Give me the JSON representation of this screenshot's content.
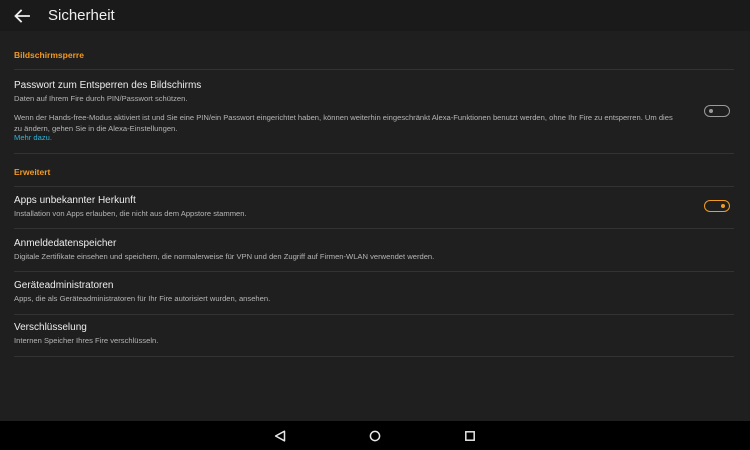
{
  "header": {
    "title": "Sicherheit",
    "back_icon": "arrow-left-icon"
  },
  "sections": {
    "screen_lock": {
      "heading": "Bildschirmsperre",
      "password": {
        "title": "Passwort zum Entsperren des Bildschirms",
        "subtitle": "Daten auf Ihrem Fire durch PIN/Passwort schützen.",
        "description": "Wenn der Hands-free-Modus aktiviert ist und Sie eine PIN/ein Passwort eingerichtet haben, können weiterhin eingeschränkt Alexa-Funktionen benutzt werden, ohne Ihr Fire zu entsperren. Um dies zu ändern, gehen Sie in die Alexa-Einstellungen.",
        "link": "Mehr dazu.",
        "toggle_on": false
      }
    },
    "advanced": {
      "heading": "Erweitert",
      "items": [
        {
          "title": "Apps unbekannter Herkunft",
          "subtitle": "Installation von Apps erlauben, die nicht aus dem Appstore stammen.",
          "toggle_on": true
        },
        {
          "title": "Anmeldedatenspeicher",
          "subtitle": "Digitale Zertifikate einsehen und speichern, die normalerweise für VPN und den Zugriff auf Firmen-WLAN verwendet werden."
        },
        {
          "title": "Geräteadministratoren",
          "subtitle": "Apps, die als Geräteadministratoren für Ihr Fire autorisiert wurden, ansehen."
        },
        {
          "title": "Verschlüsselung",
          "subtitle": "Internen Speicher Ihres Fire verschlüsseln."
        }
      ]
    }
  },
  "navbar": {
    "icons": [
      "back-triangle-icon",
      "home-circle-icon",
      "recents-square-icon"
    ]
  },
  "colors": {
    "accent": "#f29a22",
    "link": "#2fb4d8",
    "background": "#1f1f1f"
  }
}
